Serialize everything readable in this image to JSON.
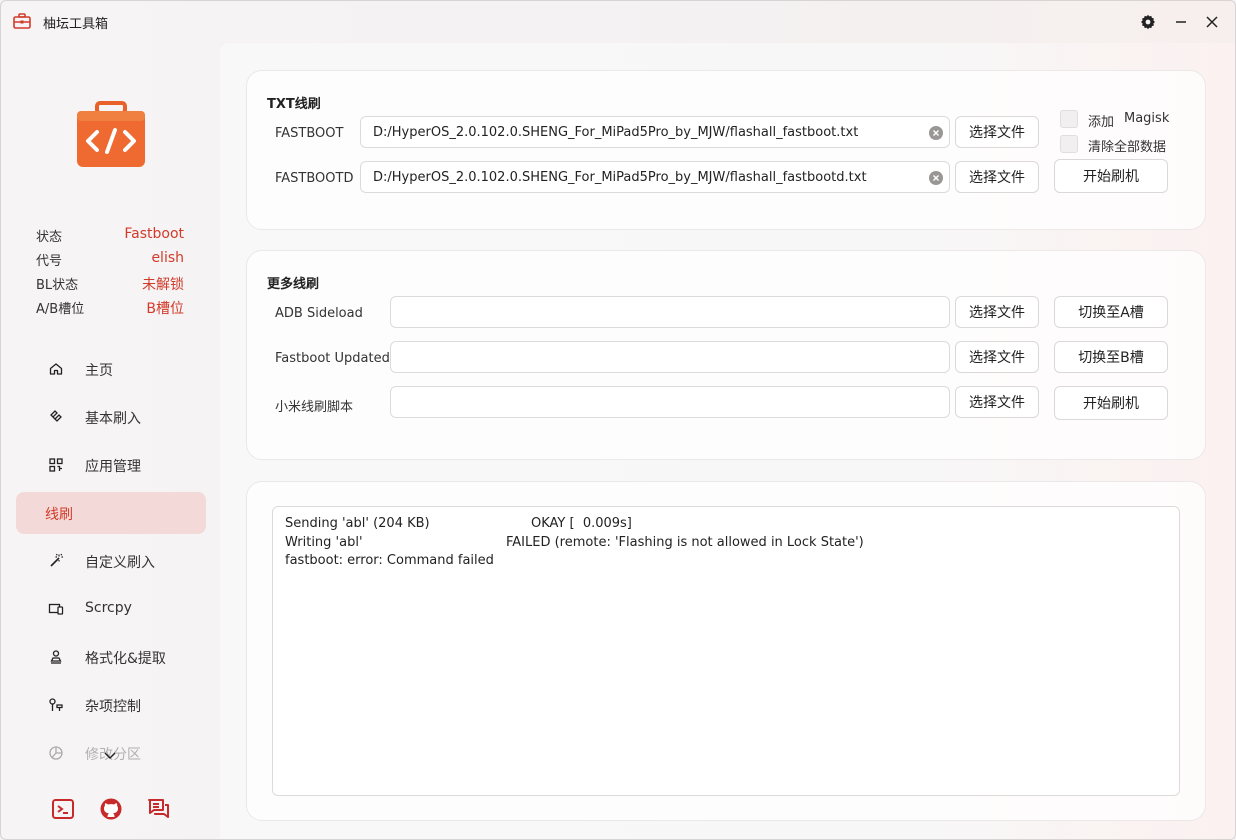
{
  "window": {
    "title": "柚坛工具箱",
    "accent": "#d23b2a"
  },
  "titlebar": {
    "settings_icon": "gear-icon",
    "minimize_icon": "minimize-icon",
    "close_icon": "close-icon"
  },
  "device": [
    {
      "key": "状态",
      "value": "Fastboot"
    },
    {
      "key": "代号",
      "value": "elish"
    },
    {
      "key": "BL状态",
      "value": "未解锁"
    },
    {
      "key": "A/B槽位",
      "value": "B槽位"
    }
  ],
  "nav": [
    {
      "label": "主页",
      "icon": "home-icon"
    },
    {
      "label": "基本刷入",
      "icon": "flash-icon"
    },
    {
      "label": "应用管理",
      "icon": "apps-icon"
    },
    {
      "label": "线刷",
      "icon": "",
      "active": true
    },
    {
      "label": "自定义刷入",
      "icon": "wand-icon"
    },
    {
      "label": "Scrcpy",
      "icon": "screen-mirror-icon"
    },
    {
      "label": "格式化&提取",
      "icon": "format-icon"
    },
    {
      "label": "杂项控制",
      "icon": "tools-icon"
    },
    {
      "label": "修改分区",
      "icon": "partition-icon"
    }
  ],
  "txt_flash": {
    "title": "TXT线刷",
    "fastboot_label": "FASTBOOT",
    "fastboot_path": "D:/HyperOS_2.0.102.0.SHENG_For_MiPad5Pro_by_MJW/flashall_fastboot.txt",
    "fastbootd_label": "FASTBOOTD",
    "fastbootd_path": "D:/HyperOS_2.0.102.0.SHENG_For_MiPad5Pro_by_MJW/flashall_fastbootd.txt",
    "choose_file": "选择文件",
    "add_label": "添加",
    "magisk_label": "Magisk",
    "wipe_label": "清除全部数据",
    "start_flash": "开始刷机"
  },
  "more_flash": {
    "title": "更多线刷",
    "adb_label": "ADB Sideload",
    "adb_value": "",
    "fbupd_label": "Fastboot Updated",
    "fbupd_value": "",
    "xiaomi_label": "小米线刷脚本",
    "xiaomi_value": "",
    "choose_file": "选择文件",
    "switch_a": "切换至A槽",
    "switch_b": "切换至B槽",
    "start_flash": "开始刷机"
  },
  "log": {
    "lines": [
      {
        "left": "Sending 'abl' (204 KB)",
        "right": "OKAY [  0.009s]"
      },
      {
        "left": "Writing 'abl'",
        "right": "FAILED (remote: 'Flashing is not allowed in Lock State')"
      },
      {
        "left": "fastboot: error: Command failed",
        "right": ""
      }
    ]
  },
  "footer": {
    "icons": [
      "terminal-icon",
      "github-icon",
      "chat-icon"
    ]
  }
}
